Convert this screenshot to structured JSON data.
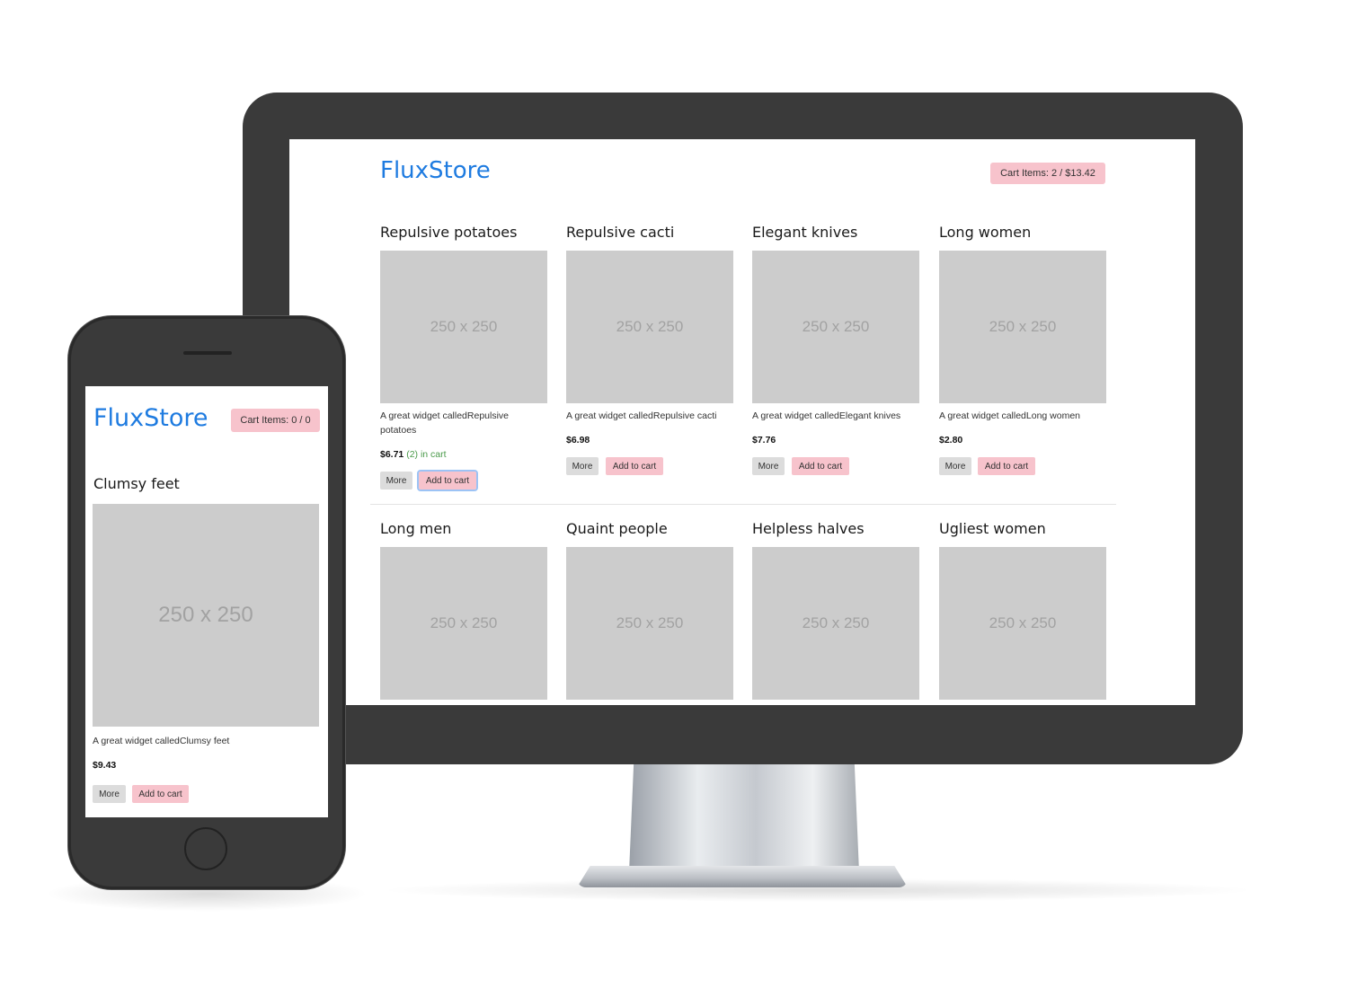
{
  "desktop": {
    "brand": "FluxStore",
    "cart_label": "Cart Items: 2 / $13.42",
    "products": [
      {
        "title": "Repulsive potatoes",
        "image_label": "250 x 250",
        "desc": "A great widget calledRepulsive potatoes",
        "price": "$6.71",
        "in_cart": "(2) in cart",
        "more_label": "More",
        "add_label": "Add to cart"
      },
      {
        "title": "Repulsive cacti",
        "image_label": "250 x 250",
        "desc": "A great widget calledRepulsive cacti",
        "price": "$6.98",
        "more_label": "More",
        "add_label": "Add to cart"
      },
      {
        "title": "Elegant knives",
        "image_label": "250 x 250",
        "desc": "A great widget calledElegant knives",
        "price": "$7.76",
        "more_label": "More",
        "add_label": "Add to cart"
      },
      {
        "title": "Long women",
        "image_label": "250 x 250",
        "desc": "A great widget calledLong women",
        "price": "$2.80",
        "more_label": "More",
        "add_label": "Add to cart"
      }
    ],
    "products_row2": [
      {
        "title": "Long men",
        "image_label": "250 x 250"
      },
      {
        "title": "Quaint people",
        "image_label": "250 x 250"
      },
      {
        "title": "Helpless halves",
        "image_label": "250 x 250"
      },
      {
        "title": "Ugliest women",
        "image_label": "250 x 250"
      }
    ]
  },
  "mobile": {
    "brand": "FluxStore",
    "cart_label": "Cart Items: 0 / 0",
    "product": {
      "title": "Clumsy feet",
      "image_label": "250 x 250",
      "desc": "A great widget calledClumsy feet",
      "price": "$9.43",
      "more_label": "More",
      "add_label": "Add to cart"
    }
  },
  "colors": {
    "brand": "#1e7be0",
    "cart_badge": "#f7c3cc",
    "placeholder": "#cccccc",
    "in_cart": "#4a9a4a",
    "device_frame": "#3a3a3a"
  }
}
